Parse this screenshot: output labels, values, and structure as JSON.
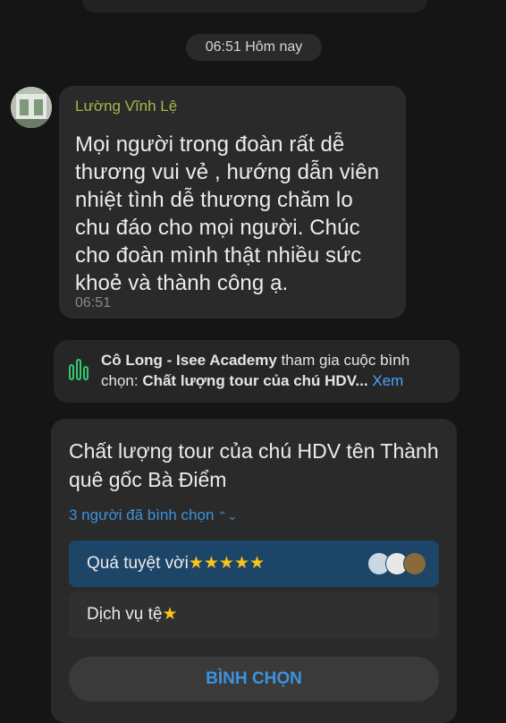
{
  "divider": {
    "time_label": "06:51 Hôm nay"
  },
  "message": {
    "sender": "Lường Vĩnh Lệ",
    "text": "Mọi người trong đoàn rất dễ thương vui vẻ , hướng dẫn viên nhiệt tình dễ thương chăm lo chu đáo cho mọi người. Chúc cho đoàn mình thật nhiều sức khoẻ và thành công ạ.",
    "time": "06:51"
  },
  "notice": {
    "actor": "Cô Long - Isee Academy",
    "action": " tham gia cuộc bình chọn: ",
    "poll_ref": "Chất lượng tour của chú HDV...",
    "link": " Xem"
  },
  "poll": {
    "title": "Chất lượng tour của chú HDV tên Thành quê gốc Bà Điểm",
    "voters": "3 người đã bình chọn",
    "options": [
      {
        "label": "Quá tuyệt vời",
        "stars": "★★★★★",
        "selected": true
      },
      {
        "label": "Dịch vụ tệ",
        "stars": "★",
        "selected": false
      }
    ],
    "vote_button": "BÌNH CHỌN"
  },
  "colors": {
    "accent": "#3c92e0",
    "sender": "#a8b64a",
    "selected_option": "#1d4567"
  }
}
